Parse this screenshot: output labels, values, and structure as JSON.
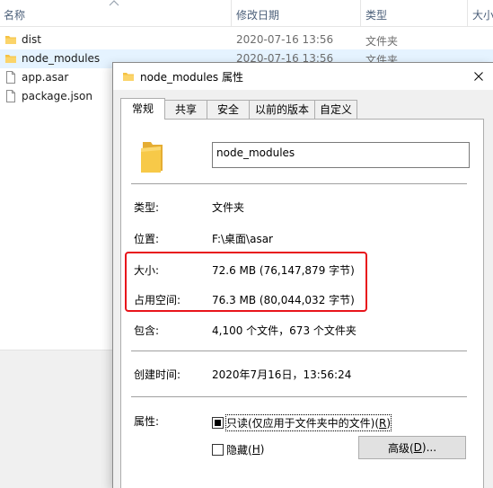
{
  "explorer": {
    "columns": {
      "name": "名称",
      "date": "修改日期",
      "type": "类型",
      "size": "大小"
    },
    "rows": [
      {
        "name": "dist",
        "date": "2020-07-16 13:56",
        "type": "文件夹",
        "icon": "folder-icon"
      },
      {
        "name": "node_modules",
        "date": "2020-07-16 13:56",
        "type": "文件夹",
        "icon": "folder-icon",
        "selected": true
      },
      {
        "name": "app.asar",
        "icon": "file-icon"
      },
      {
        "name": "package.json",
        "icon": "file-icon"
      }
    ]
  },
  "dialog": {
    "title": "node_modules 属性",
    "tabs": [
      "常规",
      "共享",
      "安全",
      "以前的版本",
      "自定义"
    ],
    "active_tab": "常规",
    "folder_name": "node_modules",
    "fields": {
      "type_label": "类型:",
      "type_value": "文件夹",
      "location_label": "位置:",
      "location_value": "F:\\桌面\\asar",
      "size_label": "大小:",
      "size_value": "72.6 MB (76,147,879 字节)",
      "disk_label": "占用空间:",
      "disk_value": "76.3 MB (80,044,032 字节)",
      "contains_label": "包含:",
      "contains_value": "4,100 个文件，673 个文件夹",
      "created_label": "创建时间:",
      "created_value": "2020年7月16日，13:56:24",
      "attributes_label": "属性:"
    },
    "readonly": {
      "text": "只读(仅应用于文件夹中的文件)(",
      "hotkey": "R",
      "suffix": ")",
      "state": "indeterminate"
    },
    "hidden": {
      "text": "隐藏(",
      "hotkey": "H",
      "suffix": ")",
      "checked": false
    },
    "advanced_button": {
      "text": "高级(",
      "hotkey": "D",
      "suffix": ")..."
    }
  },
  "colors": {
    "highlight_box": "#e8141b",
    "folder": "#f5c242",
    "selection": "#e5f3ff"
  }
}
